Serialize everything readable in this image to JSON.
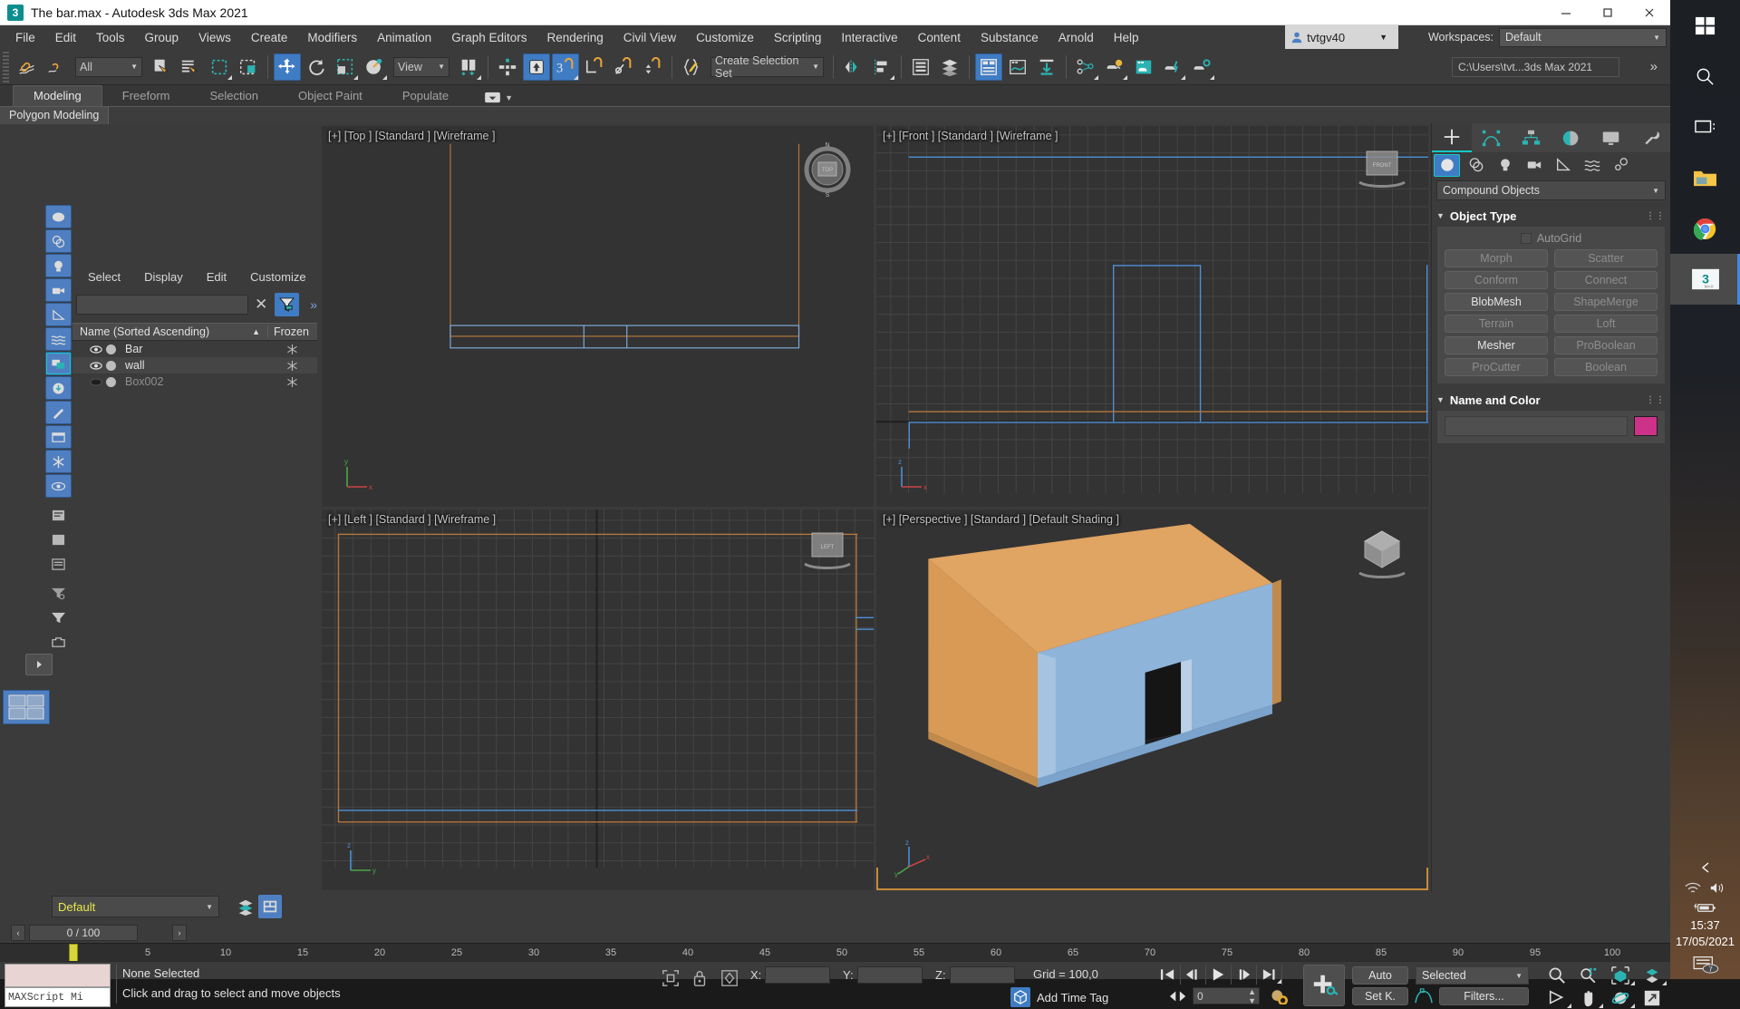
{
  "window": {
    "title": "The bar.max - Autodesk 3ds Max 2021",
    "app_icon": "3dsmax-icon",
    "minimize": "–",
    "maximize": "☐",
    "close": "✕"
  },
  "menubar": {
    "items": [
      "File",
      "Edit",
      "Tools",
      "Group",
      "Views",
      "Create",
      "Modifiers",
      "Animation",
      "Graph Editors",
      "Rendering",
      "Civil View",
      "Customize",
      "Scripting",
      "Interactive",
      "Content",
      "Substance",
      "Arnold",
      "Help"
    ],
    "user": "tvtgv40",
    "workspaces_label": "Workspaces:",
    "workspace_value": "Default"
  },
  "toolbar": {
    "selection_filter": "All",
    "reference_coord": "View",
    "selection_set": "Create Selection Set",
    "project_path": "C:\\Users\\tvt...3ds Max 2021",
    "overflow": "»"
  },
  "ribbon": {
    "tabs": [
      "Modeling",
      "Freeform",
      "Selection",
      "Object Paint",
      "Populate"
    ],
    "active_tab": "Modeling",
    "subtab": "Polygon Modeling"
  },
  "explorer": {
    "menus": [
      "Select",
      "Display",
      "Edit",
      "Customize"
    ],
    "search_value": "",
    "columns": [
      "Name (Sorted Ascending)",
      "Frozen"
    ],
    "rows": [
      {
        "name": "Bar",
        "visible": true,
        "frozen_icon": "freeze-icon",
        "dimmed": false
      },
      {
        "name": "wall",
        "visible": true,
        "frozen_icon": "freeze-icon",
        "dimmed": false
      },
      {
        "name": "Box002",
        "visible": false,
        "frozen_icon": "freeze-icon",
        "dimmed": true
      }
    ]
  },
  "viewports": [
    {
      "label": "[+] [Top ] [Standard ] [Wireframe ]",
      "active": false,
      "type": "top"
    },
    {
      "label": "[+] [Front ] [Standard ] [Wireframe ]",
      "active": false,
      "type": "front"
    },
    {
      "label": "[+] [Left ] [Standard ] [Wireframe ]",
      "active": false,
      "type": "left"
    },
    {
      "label": "[+] [Perspective ] [Standard ] [Default Shading ]",
      "active": true,
      "type": "perspective"
    }
  ],
  "command_panel": {
    "tabs": [
      "create-tab",
      "modify-tab",
      "hierarchy-tab",
      "motion-tab",
      "display-tab",
      "utilities-tab"
    ],
    "category_buttons": [
      "geometry-icon",
      "shapes-icon",
      "lights-icon",
      "cameras-icon",
      "helpers-icon",
      "space-warps-icon",
      "systems-icon"
    ],
    "subcategory": "Compound Objects",
    "object_type": {
      "title": "Object Type",
      "autogrid": "AutoGrid",
      "buttons": [
        {
          "label": "Morph",
          "enabled": false
        },
        {
          "label": "Scatter",
          "enabled": false
        },
        {
          "label": "Conform",
          "enabled": false
        },
        {
          "label": "Connect",
          "enabled": false
        },
        {
          "label": "BlobMesh",
          "enabled": true
        },
        {
          "label": "ShapeMerge",
          "enabled": false
        },
        {
          "label": "Terrain",
          "enabled": false
        },
        {
          "label": "Loft",
          "enabled": false
        },
        {
          "label": "Mesher",
          "enabled": true
        },
        {
          "label": "ProBoolean",
          "enabled": false
        },
        {
          "label": "ProCutter",
          "enabled": false
        },
        {
          "label": "Boolean",
          "enabled": false
        }
      ]
    },
    "name_and_color": {
      "title": "Name and Color",
      "name_value": "",
      "color": "#CC3388"
    }
  },
  "bottom": {
    "layer_combo": "Default",
    "frame_nav_prev": "‹",
    "frame_nav_next": "›",
    "frame_range": "0 / 100",
    "ruler_ticks": [
      "5",
      "10",
      "15",
      "20",
      "25",
      "30",
      "35",
      "40",
      "45",
      "50",
      "55",
      "60",
      "65",
      "70",
      "75",
      "80",
      "85",
      "90",
      "95",
      "100"
    ],
    "maxscript_label": "MAXScript Mi",
    "status_selection": "None Selected",
    "status_prompt": "Click and drag to select and move objects",
    "coords": {
      "x_label": "X:",
      "x_value": "",
      "y_label": "Y:",
      "y_value": "",
      "z_label": "Z:",
      "z_value": ""
    },
    "grid": "Grid = 100,0",
    "add_time_tag": "Add Time Tag",
    "current_frame": "0",
    "auto_key": "Auto",
    "set_key": "Set K.",
    "key_filter_mode": "Selected",
    "filters": "Filters..."
  },
  "taskbar": {
    "apps": [
      "windows-start-icon",
      "search-icon",
      "task-view-icon",
      "file-explorer-icon",
      "chrome-icon",
      "3dsmax-icon"
    ],
    "active_app": "3dsmax-icon",
    "tray": [
      "chevron-up-icon",
      "wifi-icon",
      "volume-icon",
      "battery-icon"
    ],
    "time": "15:37",
    "date": "17/05/2021",
    "notifications": "notification-icon"
  }
}
